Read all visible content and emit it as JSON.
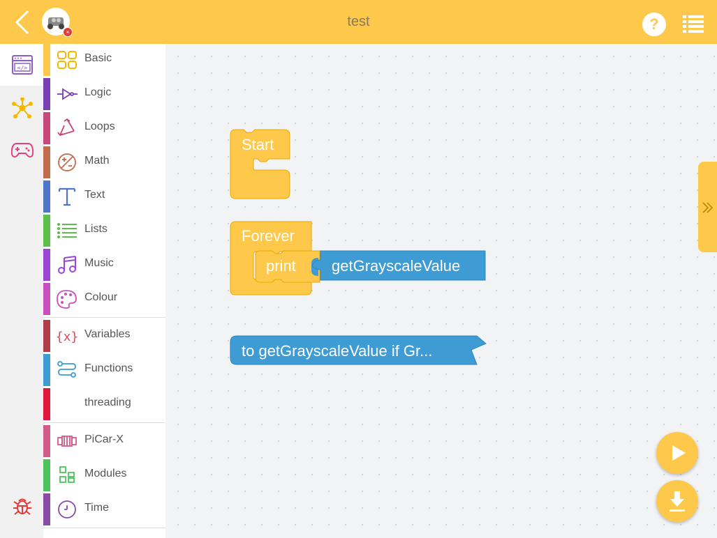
{
  "header": {
    "title": "test"
  },
  "categories": [
    {
      "label": "Basic",
      "color": "#fec84a",
      "icon": "basic-grid-icon"
    },
    {
      "label": "Logic",
      "color": "#7b3fb5",
      "icon": "logic-gate-icon"
    },
    {
      "label": "Loops",
      "color": "#c9467a",
      "icon": "loops-recycle-icon"
    },
    {
      "label": "Math",
      "color": "#c26a4a",
      "icon": "math-icon"
    },
    {
      "label": "Text",
      "color": "#4e75c7",
      "icon": "text-icon"
    },
    {
      "label": "Lists",
      "color": "#5cbf4a",
      "icon": "lists-icon"
    },
    {
      "label": "Music",
      "color": "#9b45d6",
      "icon": "music-icon"
    },
    {
      "label": "Colour",
      "color": "#c94fbf",
      "icon": "palette-icon"
    },
    {
      "label": "Variables",
      "color": "#b03d4a",
      "icon": "variables-icon"
    },
    {
      "label": "Functions",
      "color": "#3e9bd4",
      "icon": "functions-icon"
    },
    {
      "label": "threading",
      "color": "#e0173a",
      "icon": ""
    },
    {
      "label": "PiCar-X",
      "color": "#d25a8a",
      "icon": "picar-icon"
    },
    {
      "label": "Modules",
      "color": "#4cc35a",
      "icon": "modules-icon"
    },
    {
      "label": "Time",
      "color": "#8a4aa6",
      "icon": "clock-icon"
    }
  ],
  "blocks": {
    "start": "Start",
    "forever": "Forever",
    "print": "print",
    "getgray": "getGrayscaleValue",
    "func_def": "to getGrayscaleValue  if Gr..."
  },
  "colors": {
    "accent": "#fec84a",
    "block_yellow": "#fec84a",
    "block_blue": "#3e9bd4"
  }
}
